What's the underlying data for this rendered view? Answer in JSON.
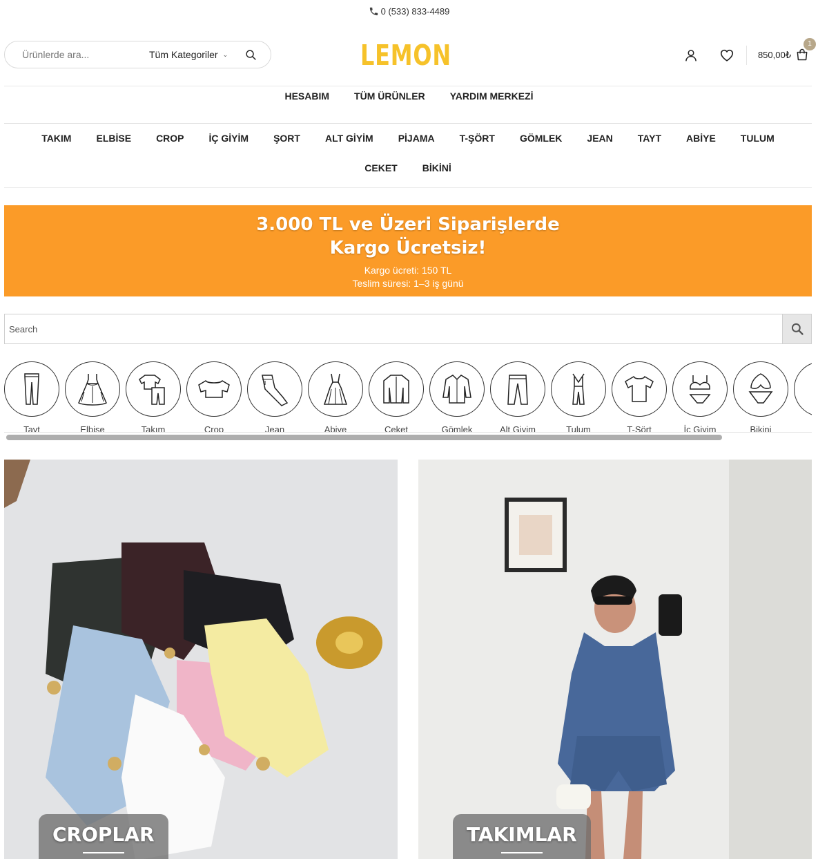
{
  "topbar": {
    "phone": "0 (533) 833-4489",
    "phone_icon": "phone-icon"
  },
  "header": {
    "search_placeholder": "Ürünlerde ara...",
    "category_select": "Tüm Kategoriler",
    "logo": "LEMON",
    "cart_total": "850,00₺",
    "cart_count": "1",
    "icons": [
      "account-icon",
      "heart-icon",
      "cart-icon",
      "search-icon"
    ]
  },
  "top_menu": [
    "HESABIM",
    "TÜM ÜRÜNLER",
    "YARDIM MERKEZİ"
  ],
  "category_nav": [
    "TAKIM",
    "ELBİSE",
    "CROP",
    "İÇ GİYİM",
    "ŞORT",
    "ALT GİYİM",
    "PİJAMA",
    "T-ŞÖRT",
    "GÖMLEK",
    "JEAN",
    "TAYT",
    "ABİYE",
    "TULUM",
    "CEKET",
    "BİKİNİ"
  ],
  "banner": {
    "title_line1": "3.000 TL ve Üzeri Siparişlerde",
    "title_line2": "Kargo Ücretsiz!",
    "line1": "Kargo ücreti: 150 TL",
    "line2": "Teslim süresi: 1–3 iş günü",
    "color": "#fb9b28"
  },
  "search2": {
    "placeholder": "Search"
  },
  "category_icons": [
    {
      "label": "Tayt",
      "icon": "leggings-icon"
    },
    {
      "label": "Elbise",
      "icon": "dress-icon"
    },
    {
      "label": "Takım",
      "icon": "outfit-set-icon"
    },
    {
      "label": "Crop",
      "icon": "crop-top-icon"
    },
    {
      "label": "Jean",
      "icon": "jeans-icon"
    },
    {
      "label": "Abiye",
      "icon": "evening-dress-icon"
    },
    {
      "label": "Ceket",
      "icon": "jacket-icon"
    },
    {
      "label": "Gömlek",
      "icon": "shirt-icon"
    },
    {
      "label": "Alt Giyim",
      "icon": "trousers-icon"
    },
    {
      "label": "Tulum",
      "icon": "jumpsuit-icon"
    },
    {
      "label": "T-Şört",
      "icon": "tshirt-icon"
    },
    {
      "label": "İç Giyim",
      "icon": "lingerie-icon"
    },
    {
      "label": "Bikini",
      "icon": "bikini-icon"
    },
    {
      "label": "",
      "icon": "swimsuit-icon"
    }
  ],
  "cards": [
    {
      "label": "CROPLAR"
    },
    {
      "label": "TAKIMLAR"
    }
  ]
}
